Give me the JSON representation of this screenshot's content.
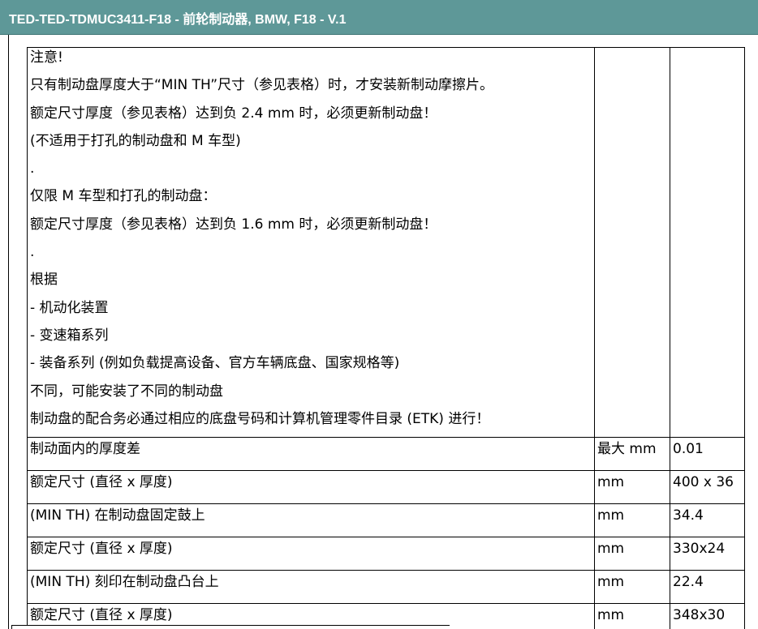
{
  "header": {
    "title": "TED-TED-TDMUC3411-F18 - 前轮制动器, BMW, F18 - V.1"
  },
  "note": {
    "lines": [
      "注意!",
      "只有制动盘厚度大于“MIN TH”尺寸（参见表格）时，才安装新制动摩擦片。",
      "额定尺寸厚度（参见表格）达到负 2.4 mm 时，必须更新制动盘！",
      "(不适用于打孔的制动盘和 M 车型)",
      ".",
      "仅限 M 车型和打孔的制动盘：",
      "额定尺寸厚度（参见表格）达到负 1.6 mm 时，必须更新制动盘！",
      ".",
      "根据",
      "- 机动化装置",
      "- 变速箱系列",
      "- 装备系列 (例如负载提高设备、官方车辆底盘、国家规格等)",
      "不同，可能安装了不同的制动盘",
      "制动盘的配合务必通过相应的底盘号码和计算机管理零件目录 (ETK) 进行！"
    ]
  },
  "rows": [
    {
      "label": "制动面内的厚度差",
      "unit": "最大 mm",
      "value": "0.01"
    },
    {
      "label": "额定尺寸 (直径 x 厚度)",
      "unit": "mm",
      "value": "400 x 36"
    },
    {
      "label": "(MIN TH) 在制动盘固定鼓上",
      "unit": "mm",
      "value": "34.4"
    },
    {
      "label": "额定尺寸 (直径 x 厚度)",
      "unit": "mm",
      "value": "330x24"
    },
    {
      "label": "(MIN TH) 刻印在制动盘凸台上",
      "unit": "mm",
      "value": "22.4"
    },
    {
      "label": "额定尺寸 (直径 x 厚度)",
      "unit": "mm",
      "value": "348x30"
    }
  ]
}
